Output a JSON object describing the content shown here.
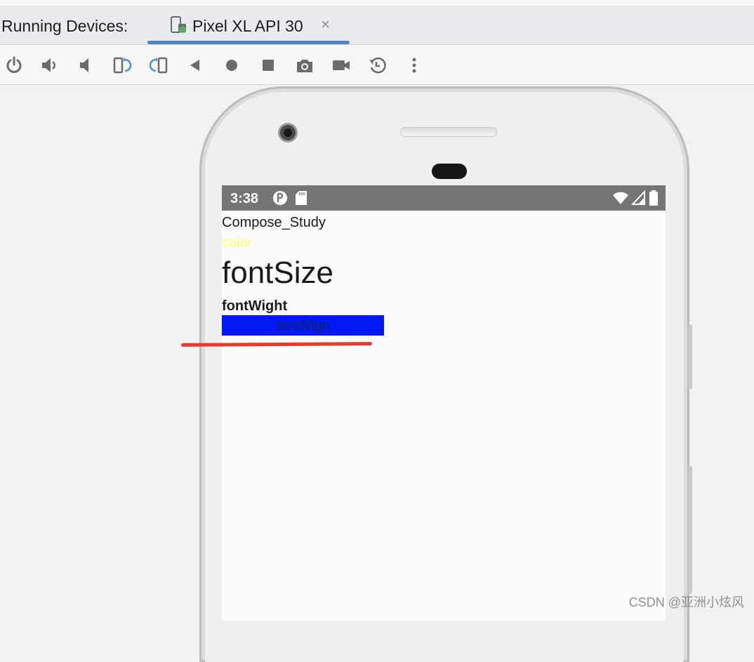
{
  "header": {
    "running_label": "Running Devices:",
    "device_tab_label": "Pixel XL API 30",
    "close_glyph": "×"
  },
  "toolbar": {
    "buttons": [
      {
        "name": "power-icon"
      },
      {
        "name": "volume-up-icon"
      },
      {
        "name": "volume-down-icon"
      },
      {
        "name": "rotate-left-icon"
      },
      {
        "name": "rotate-right-icon"
      },
      {
        "name": "back-icon"
      },
      {
        "name": "home-icon"
      },
      {
        "name": "overview-icon"
      },
      {
        "name": "camera-icon"
      },
      {
        "name": "screen-record-icon"
      },
      {
        "name": "snapshot-history-icon"
      },
      {
        "name": "more-options-icon"
      }
    ],
    "accent_color": "#4a90d9"
  },
  "device": {
    "status_time": "3:38"
  },
  "app": {
    "title": "Compose_Study",
    "color_text": "color",
    "font_size_text": "fontSize",
    "font_weight_text": "fontWight",
    "text_align_text": "textAlign",
    "color_text_color": "#ffff66",
    "align_box_color": "#0018f8"
  },
  "watermark": "CSDN @亚洲小炫风"
}
